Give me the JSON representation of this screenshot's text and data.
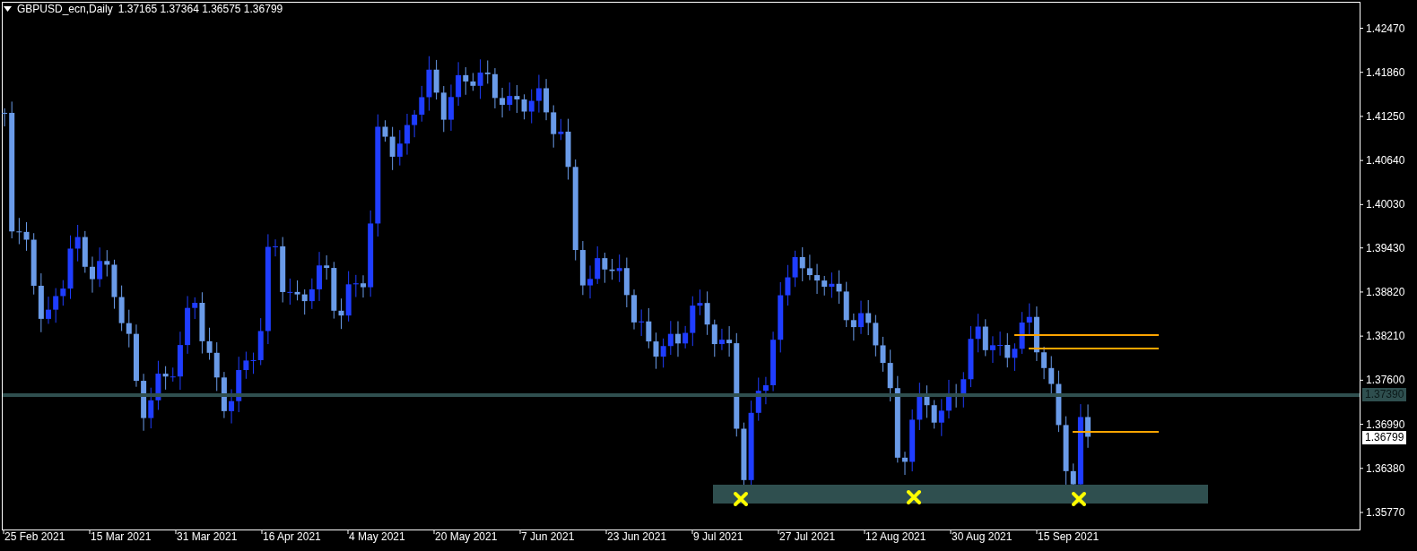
{
  "header": {
    "symbol": "GBPUSD_ecn,Daily",
    "ohlc": "1.37165 1.37364 1.36575 1.36799"
  },
  "price_axis": [
    "1.42470",
    "1.41860",
    "1.41250",
    "1.40640",
    "1.40030",
    "1.39430",
    "1.38820",
    "1.38210",
    "1.37600",
    "1.36990",
    "1.36380",
    "1.35770"
  ],
  "time_axis": [
    "25 Feb 2021",
    "15 Mar 2021",
    "31 Mar 2021",
    "16 Apr 2021",
    "4 May 2021",
    "20 May 2021",
    "7 Jun 2021",
    "23 Jun 2021",
    "9 Jul 2021",
    "27 Jul 2021",
    "12 Aug 2021",
    "30 Aug 2021",
    "15 Sep 2021"
  ],
  "price_tags": [
    {
      "text": "1.37390",
      "kind": "level"
    },
    {
      "text": "1.36799",
      "kind": "current"
    }
  ]
}
